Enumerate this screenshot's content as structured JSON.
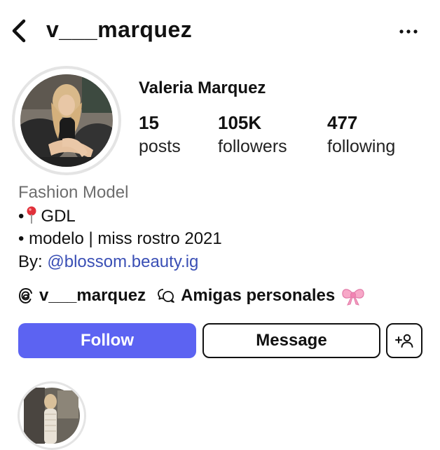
{
  "header": {
    "username": "v___marquez",
    "back_icon": "chevron-left-icon",
    "more_icon": "ellipsis-icon"
  },
  "profile": {
    "display_name": "Valeria Marquez",
    "stats": [
      {
        "value": "15",
        "label": "posts"
      },
      {
        "value": "105K",
        "label": "followers"
      },
      {
        "value": "477",
        "label": "following"
      }
    ]
  },
  "bio": {
    "category": "Fashion Model",
    "line1_bullet": "•",
    "line1_text": "GDL",
    "line2": "• modelo | miss rostro 2021",
    "line3_prefix": "By:",
    "line3_link": "@blossom.beauty.ig"
  },
  "links": {
    "threads_handle": "v___marquez",
    "group_name": "Amigas personales"
  },
  "actions": {
    "follow": "Follow",
    "message": "Message",
    "add_user_icon": "add-person-icon"
  },
  "colors": {
    "follow_bg": "#5c63f2",
    "link_blue": "#3a4fb5",
    "category_gray": "#6d6d6d"
  }
}
